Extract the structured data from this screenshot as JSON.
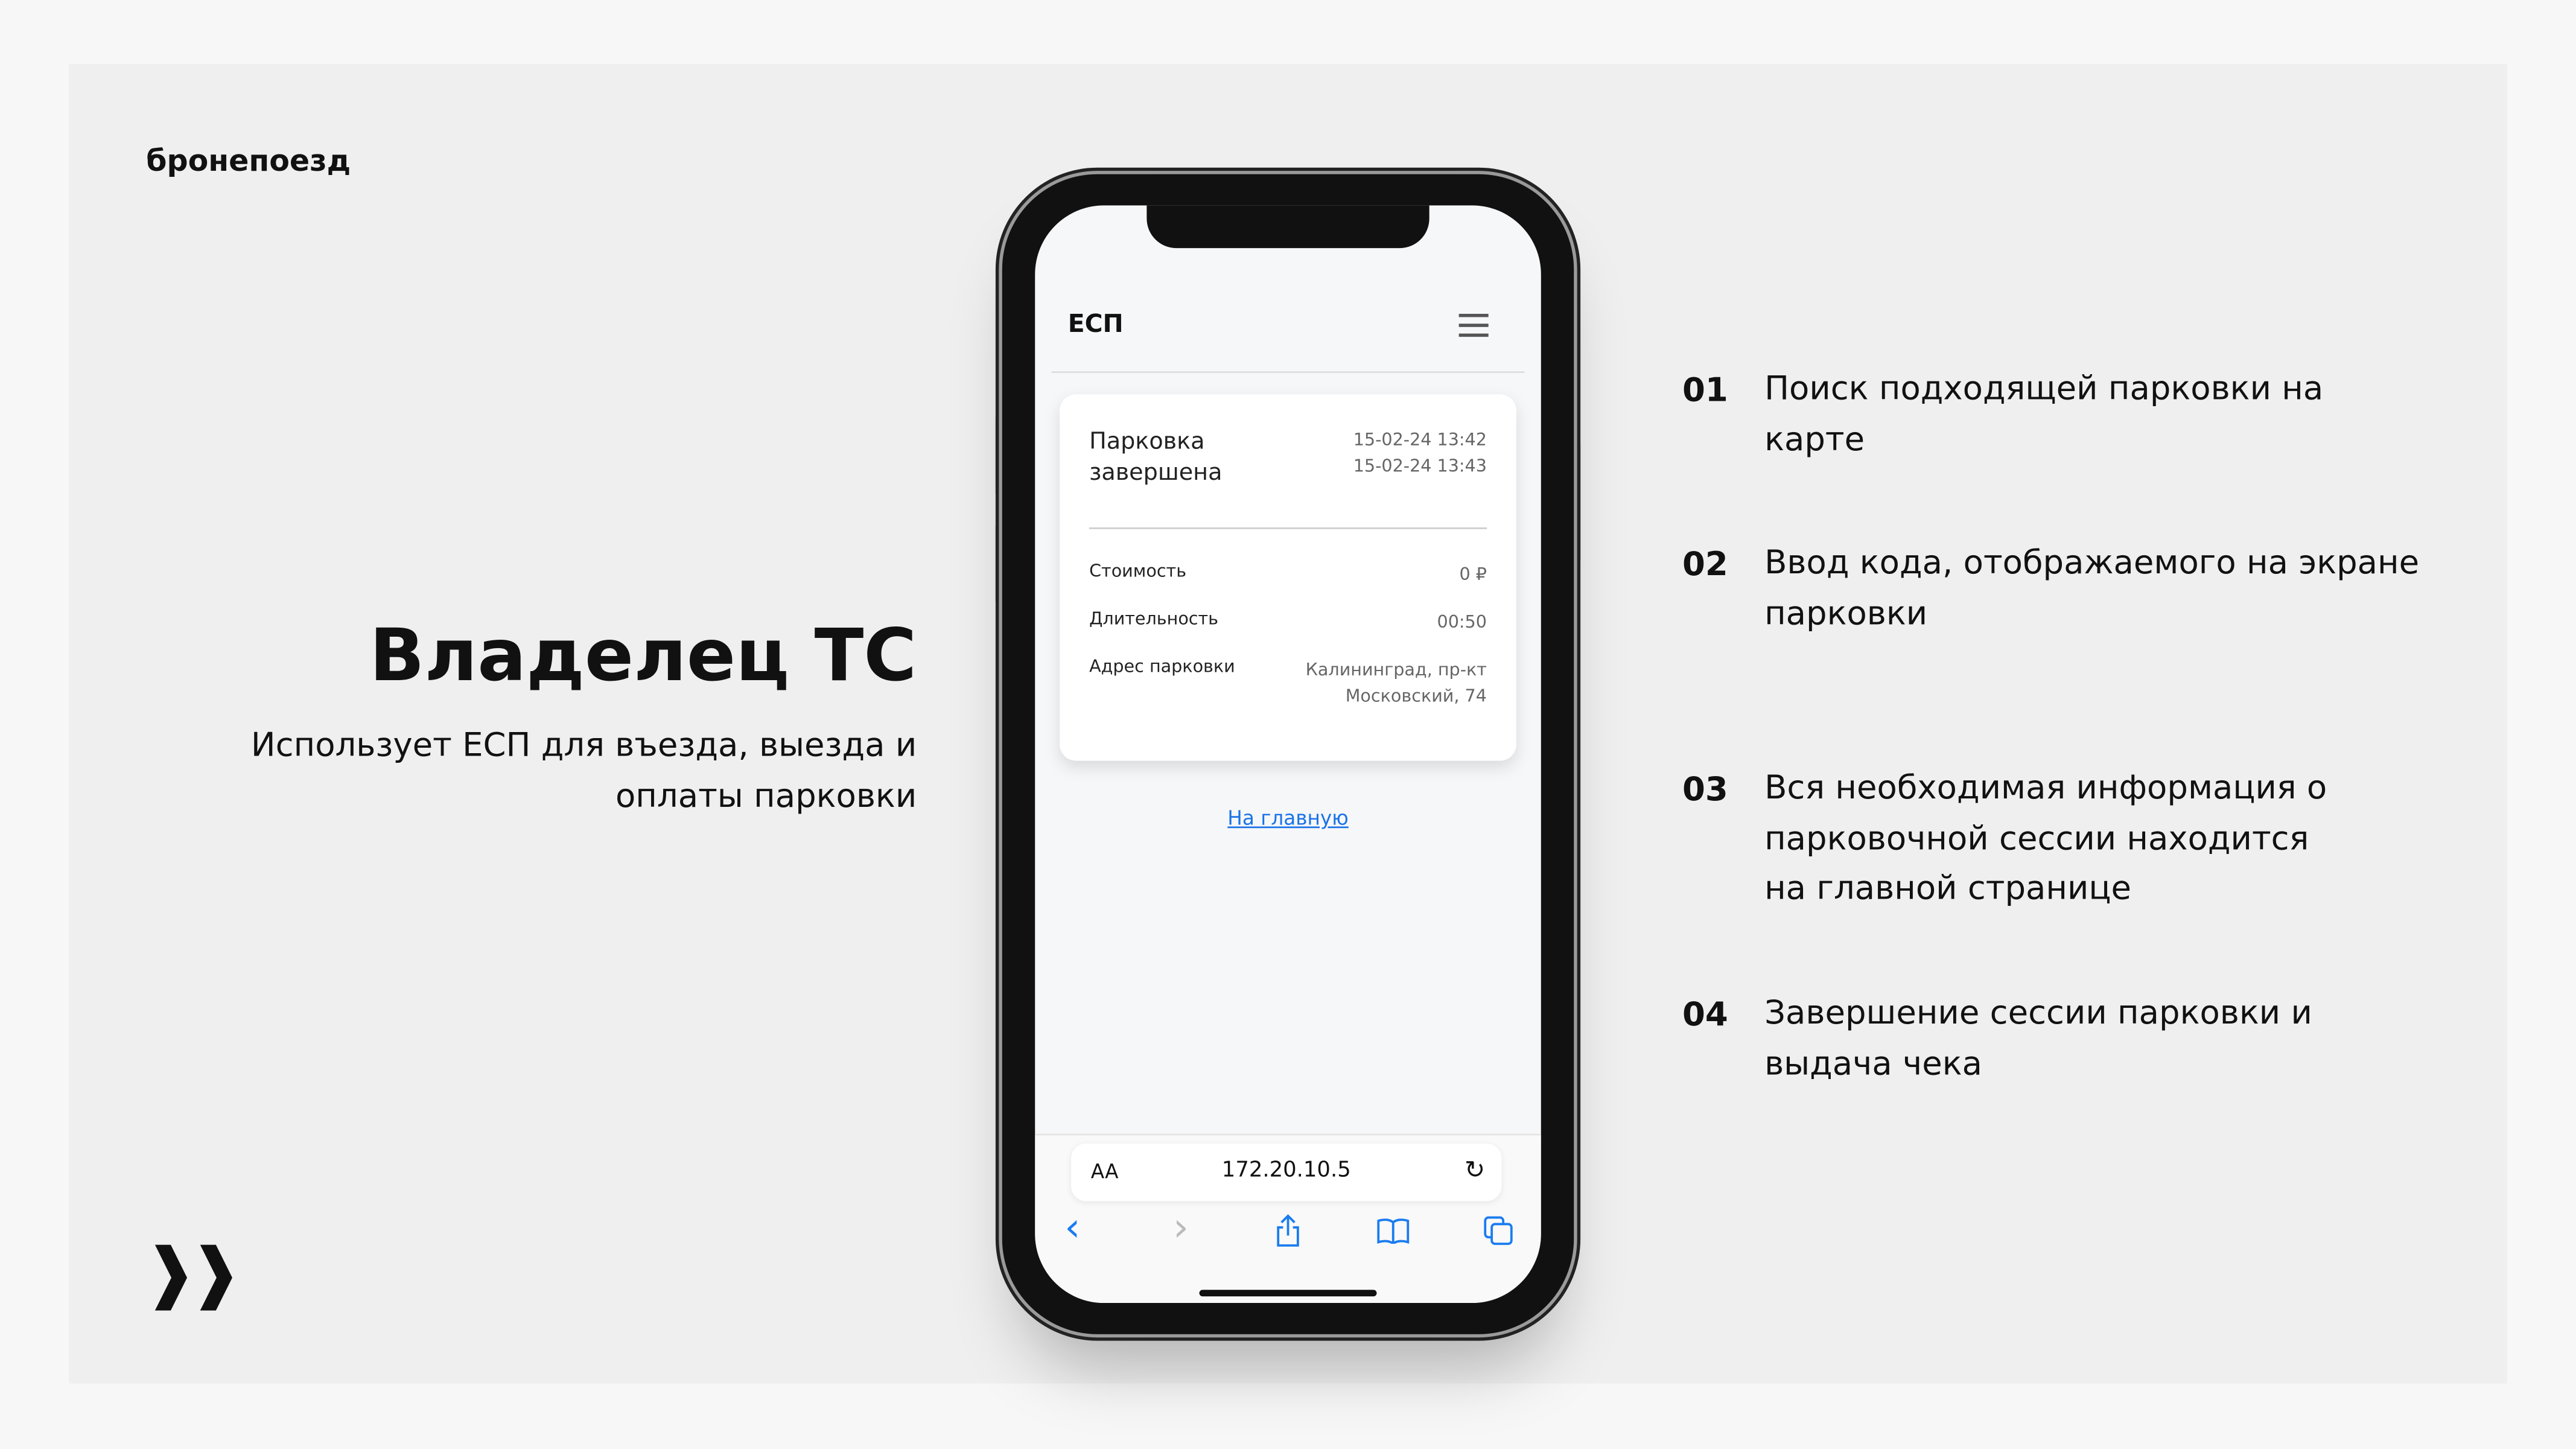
{
  "brand": "бронепоезд",
  "hero": {
    "title": "Владелец ТС",
    "subtitle": "Использует ЕСП для въезда, выезда и оплаты парковки"
  },
  "logo_mark": "»",
  "phone": {
    "header_title": "ЕСП",
    "card": {
      "status": "Парковка завершена",
      "start": "15-02-24 13:42",
      "end": "15-02-24 13:43",
      "rows": [
        {
          "label": "Стоимость",
          "value": "0 ₽"
        },
        {
          "label": "Длительность",
          "value": "00:50"
        },
        {
          "label": "Адрес парковки",
          "value": "Калининград, пр-кт Московский, 74"
        }
      ]
    },
    "home_link": "На главную",
    "browser": {
      "aa": "AA",
      "url": "172.20.10.5",
      "reload_icon": "↻",
      "back_icon": "‹",
      "forward_icon": "›"
    }
  },
  "steps": [
    {
      "num": "01",
      "text": "Поиск подходящей парковки на карте"
    },
    {
      "num": "02",
      "text": "Ввод кода, отображаемого на экране парковки"
    },
    {
      "num": "03",
      "text": "Вся необходимая информация о парковочной сессии находится на главной странице"
    },
    {
      "num": "04",
      "text": "Завершение сессии парковки и выдача чека"
    }
  ]
}
